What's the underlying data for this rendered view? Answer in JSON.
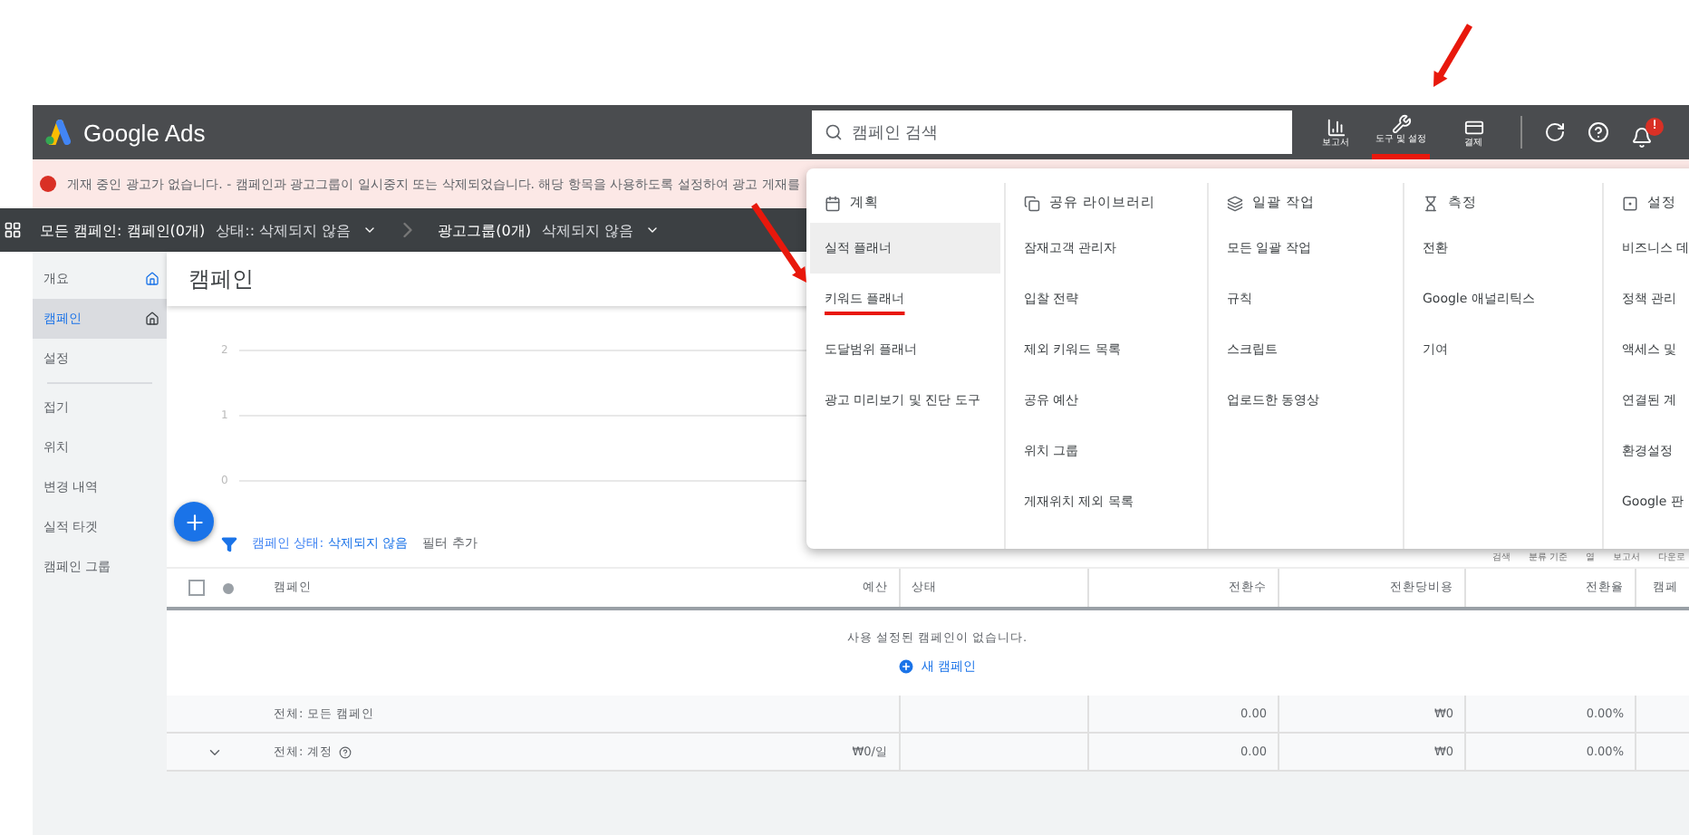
{
  "app": {
    "title": "Google Ads"
  },
  "search": {
    "placeholder": "캠페인 검색"
  },
  "top_actions": [
    {
      "kind": "reports",
      "label": "보고서",
      "highlighted": false
    },
    {
      "kind": "tools",
      "label": "도구 및 설정",
      "highlighted": true
    },
    {
      "kind": "billing",
      "label": "결제",
      "highlighted": false
    }
  ],
  "top_icons": [
    {
      "kind": "refresh"
    },
    {
      "kind": "help"
    },
    {
      "kind": "bell",
      "badge": "!"
    }
  ],
  "alert": {
    "text": "게재 중인 광고가 없습니다. - 캠페인과 광고그룹이 일시중지 또는 삭제되었습니다. 해당 항목을 사용하도록 설정하여 광고 게재를"
  },
  "breadcrumb": [
    {
      "label": "모든 캠페인:",
      "value": "캠페인(0개)",
      "filter": "상태:: 삭제되지 않음"
    },
    {
      "value": "광고그룹(0개)",
      "filter": "삭제되지 않음"
    }
  ],
  "sidebar": {
    "items": [
      {
        "label": "개요",
        "kind": "page",
        "selected": false
      },
      {
        "label": "캠페인",
        "kind": "page",
        "selected": true
      },
      {
        "label": "설정",
        "kind": "page",
        "selected": false
      },
      {
        "label": "접기",
        "kind": "toggle",
        "selected": false
      },
      {
        "label": "위치",
        "kind": "sub",
        "selected": false
      },
      {
        "label": "변경 내역",
        "kind": "sub",
        "selected": false
      },
      {
        "label": "실적 타겟",
        "kind": "sub",
        "selected": false
      },
      {
        "label": "캠페인 그룹",
        "kind": "sub",
        "selected": false
      }
    ]
  },
  "page": {
    "title": "캠페인",
    "chart_ticks": [
      "2",
      "1",
      "0"
    ]
  },
  "filter": {
    "label": "캠페인 상태:",
    "value": "삭제되지 않음",
    "add": "필터 추가"
  },
  "table_tools": [
    "검색",
    "분류 기준",
    "열",
    "보고서",
    "다운로"
  ],
  "table": {
    "columns": [
      "캠페인",
      "예산",
      "상태",
      "전환수",
      "전환당비용",
      "전환율",
      "캠페"
    ],
    "empty_message": "사용 설정된 캠페인이 없습니다.",
    "new_campaign": "새 캠페인",
    "select_all_checked": false,
    "rows": [
      {
        "expand": false,
        "info": false,
        "cells": [
          "전체: 모든 캠페인",
          "",
          "",
          "0.00",
          "₩0",
          "0.00%"
        ]
      },
      {
        "expand": true,
        "info": true,
        "cells": [
          "전체: 계정",
          "₩0/일",
          "",
          "0.00",
          "₩0",
          "0.00%"
        ]
      }
    ]
  },
  "tools_menu": {
    "columns": [
      {
        "kind": "plan",
        "title": "계획",
        "items": [
          {
            "label": "실적 플래너",
            "selected": true,
            "underlined": false
          },
          {
            "label": "키워드 플래너",
            "selected": false,
            "underlined": true
          },
          {
            "label": "도달범위 플래너",
            "selected": false,
            "underlined": false
          },
          {
            "label": "광고 미리보기 및 진단 도구",
            "selected": false,
            "underlined": false
          }
        ]
      },
      {
        "kind": "library",
        "title": "공유 라이브러리",
        "items": [
          {
            "label": "잠재고객 관리자",
            "selected": false,
            "underlined": false
          },
          {
            "label": "입찰 전략",
            "selected": false,
            "underlined": false
          },
          {
            "label": "제외 키워드 목록",
            "selected": false,
            "underlined": false
          },
          {
            "label": "공유 예산",
            "selected": false,
            "underlined": false
          },
          {
            "label": "위치 그룹",
            "selected": false,
            "underlined": false
          },
          {
            "label": "게재위치 제외 목록",
            "selected": false,
            "underlined": false
          }
        ]
      },
      {
        "kind": "bulk",
        "title": "일괄 작업",
        "items": [
          {
            "label": "모든 일괄 작업",
            "selected": false,
            "underlined": false
          },
          {
            "label": "규칙",
            "selected": false,
            "underlined": false
          },
          {
            "label": "스크립트",
            "selected": false,
            "underlined": false
          },
          {
            "label": "업로드한 동영상",
            "selected": false,
            "underlined": false
          }
        ]
      },
      {
        "kind": "measure",
        "title": "측정",
        "items": [
          {
            "label": "전환",
            "selected": false,
            "underlined": false
          },
          {
            "label": "Google 애널리틱스",
            "selected": false,
            "underlined": false
          },
          {
            "label": "기여",
            "selected": false,
            "underlined": false
          }
        ]
      },
      {
        "kind": "setup",
        "title": "설정",
        "items": [
          {
            "label": "비즈니스 데",
            "selected": false,
            "underlined": false
          },
          {
            "label": "정책 관리",
            "selected": false,
            "underlined": false
          },
          {
            "label": "액세스 및",
            "selected": false,
            "underlined": false
          },
          {
            "label": "연결된 계",
            "selected": false,
            "underlined": false
          },
          {
            "label": "환경설정",
            "selected": false,
            "underlined": false
          },
          {
            "label": "Google 판",
            "selected": false,
            "underlined": false
          }
        ]
      }
    ]
  },
  "annotations": [
    {
      "kind": "arrow"
    },
    {
      "kind": "arrow"
    }
  ]
}
